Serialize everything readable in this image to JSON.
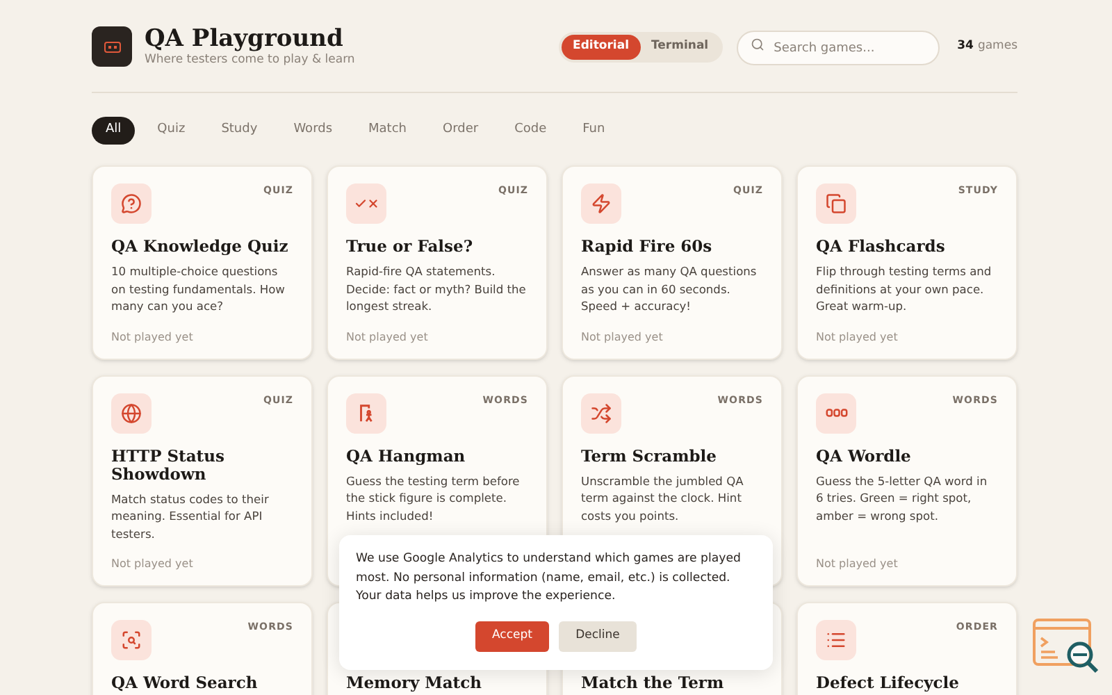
{
  "header": {
    "title": "QA Playground",
    "subtitle": "Where testers come to play & learn",
    "themes": [
      {
        "label": "Editorial",
        "selected": true
      },
      {
        "label": "Terminal",
        "selected": false
      }
    ],
    "search": {
      "placeholder": "Search games..."
    },
    "count": "34",
    "count_label": "games"
  },
  "filters": [
    {
      "label": "All",
      "selected": true
    },
    {
      "label": "Quiz",
      "selected": false
    },
    {
      "label": "Study",
      "selected": false
    },
    {
      "label": "Words",
      "selected": false
    },
    {
      "label": "Match",
      "selected": false
    },
    {
      "label": "Order",
      "selected": false
    },
    {
      "label": "Code",
      "selected": false
    },
    {
      "label": "Fun",
      "selected": false
    }
  ],
  "games": [
    {
      "kind": "question",
      "tag": "QUIZ",
      "title": "QA Knowledge Quiz",
      "description": "10 multiple-choice questions on testing fundamentals. How many can you ace?",
      "status": "Not played yet"
    },
    {
      "kind": "checkx",
      "tag": "QUIZ",
      "title": "True or False?",
      "description": "Rapid-fire QA statements. Decide: fact or myth? Build the longest streak.",
      "status": "Not played yet"
    },
    {
      "kind": "zap",
      "tag": "QUIZ",
      "title": "Rapid Fire 60s",
      "description": "Answer as many QA questions as you can in 60 seconds. Speed + accuracy!",
      "status": "Not played yet"
    },
    {
      "kind": "cards",
      "tag": "STUDY",
      "title": "QA Flashcards",
      "description": "Flip through testing terms and definitions at your own pace. Great warm-up.",
      "status": "Not played yet"
    },
    {
      "kind": "globe",
      "tag": "QUIZ",
      "title": "HTTP Status Showdown",
      "description": "Match status codes to their meaning. Essential for API testers.",
      "status": "Not played yet"
    },
    {
      "kind": "hangman",
      "tag": "WORDS",
      "title": "QA Hangman",
      "description": "Guess the testing term before the stick figure is complete. Hints included!"
    },
    {
      "kind": "shuffle",
      "tag": "WORDS",
      "title": "Term Scramble",
      "description": "Unscramble the jumbled QA term against the clock. Hint costs you points."
    },
    {
      "kind": "tiles",
      "tag": "WORDS",
      "title": "QA Wordle",
      "description": "Guess the 5-letter QA word in 6 tries. Green = right spot, amber = wrong spot.",
      "status": "Not played yet"
    },
    {
      "kind": "search",
      "tag": "WORDS",
      "title": "QA Word Search"
    },
    {
      "title": "Memory Match"
    },
    {
      "title": "Match the Term"
    },
    {
      "kind": "list",
      "tag": "ORDER",
      "title": "Defect Lifecycle"
    }
  ],
  "cookie_banner": {
    "text": "We use Google Analytics to understand which games are played most. No personal information (name, email, etc.) is collected. Your data helps us improve the experience.",
    "buttons": [
      {
        "label": "Accept",
        "kind": "primary"
      },
      {
        "label": "Decline",
        "kind": "secondary"
      }
    ]
  }
}
